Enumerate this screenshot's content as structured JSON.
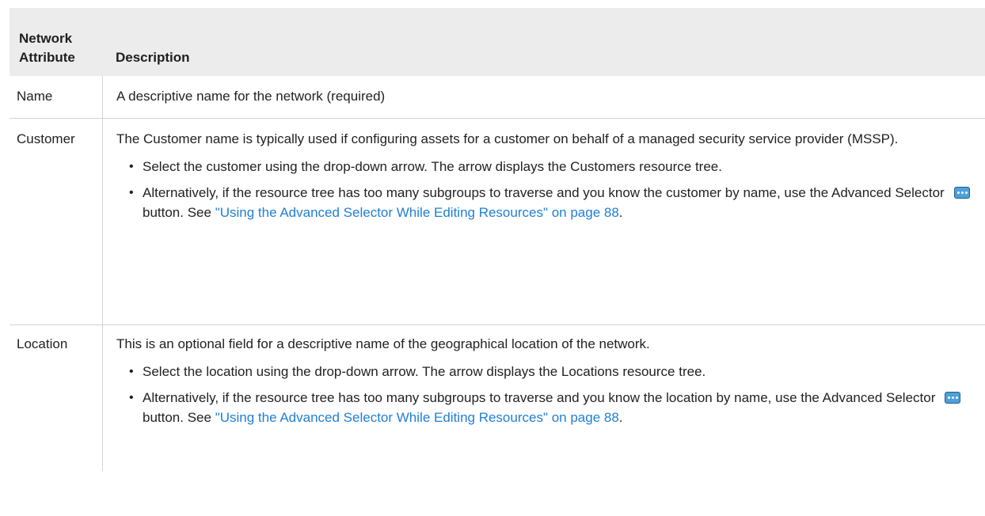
{
  "table": {
    "header": {
      "col1": "Network Attribute",
      "col1_line1": "Network",
      "col1_line2": "Attribute",
      "col2": "Description"
    },
    "rows": [
      {
        "attribute": "Name",
        "description": "A descriptive name for the network (required)"
      },
      {
        "attribute": "Customer",
        "intro": "The Customer name is typically used if configuring assets for a customer on behalf of a managed security service provider (MSSP).",
        "bullet1": "Select the customer using the drop-down arrow. The arrow displays the Customers resource tree.",
        "bullet2_text": "Alternatively, if the resource tree has too many subgroups to traverse and you know the customer by name, use the Advanced Selector",
        "bullet2_after_icon": "button. See",
        "bullet2_link": "\"Using the Advanced Selector While Editing Resources\" on page 88",
        "bullet2_end": "."
      },
      {
        "attribute": "Location",
        "intro": "This is an optional field for a descriptive name of the geographical location of the network.",
        "bullet1": "Select the location using the drop-down arrow. The arrow displays the Locations resource tree.",
        "bullet2_text": "Alternatively, if the resource tree has too many subgroups to traverse and you know the location by name, use the Advanced Selector",
        "bullet2_after_icon": "button. See",
        "bullet2_link": "\"Using the Advanced Selector While Editing Resources\" on page 88",
        "bullet2_end": "."
      }
    ]
  },
  "colors": {
    "header_bg": "#ececec",
    "link": "#1f7fd6",
    "border": "#d4d4d4",
    "icon_fill": "#4fa0d8"
  },
  "icons": {
    "advanced_selector": "ellipsis-button-icon"
  }
}
